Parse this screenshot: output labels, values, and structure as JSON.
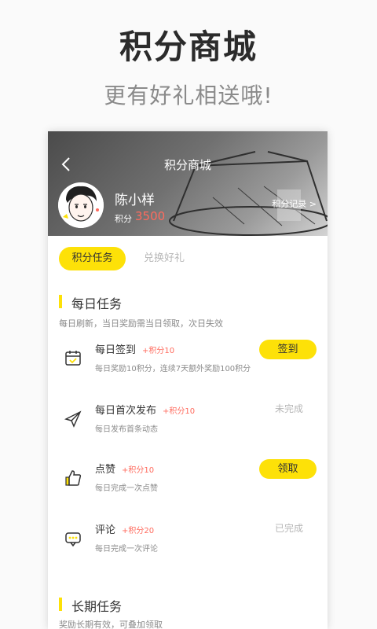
{
  "hero": {
    "title": "积分商城",
    "subtitle": "更有好礼相送哦!"
  },
  "header": {
    "back_icon": "chevron-left-icon",
    "title": "积分商城"
  },
  "user": {
    "name": "陈小样",
    "points_label": "积分",
    "points_value": "3500",
    "records_link": "积分记录 >"
  },
  "tabs": [
    {
      "label": "积分任务",
      "active": true
    },
    {
      "label": "兑换好礼",
      "active": false
    }
  ],
  "daily": {
    "title": "每日任务",
    "description": "每日刷新，当日奖励需当日领取，次日失效",
    "tasks": [
      {
        "icon": "calendar-check-icon",
        "name": "每日签到",
        "reward": "+积分10",
        "desc": "每日奖励10积分，连续7天额外奖励100积分",
        "action": "签到",
        "action_type": "button"
      },
      {
        "icon": "paper-plane-icon",
        "name": "每日首次发布",
        "reward": "+积分10",
        "desc": "每日发布首条动态",
        "action": "未完成",
        "action_type": "status"
      },
      {
        "icon": "thumbs-up-icon",
        "name": "点赞",
        "reward": "+积分10",
        "desc": "每日完成一次点赞",
        "action": "领取",
        "action_type": "button"
      },
      {
        "icon": "comment-icon",
        "name": "评论",
        "reward": "+积分20",
        "desc": "每日完成一次评论",
        "action": "已完成",
        "action_type": "status"
      }
    ]
  },
  "long_term": {
    "title": "长期任务",
    "description": "奖励长期有效，可叠加领取"
  },
  "colors": {
    "accent_yellow": "#fde108",
    "points_red": "#ff6b5e",
    "text_dark": "#333333",
    "text_gray": "#8b8b8b",
    "text_light": "#b7b7b7"
  }
}
